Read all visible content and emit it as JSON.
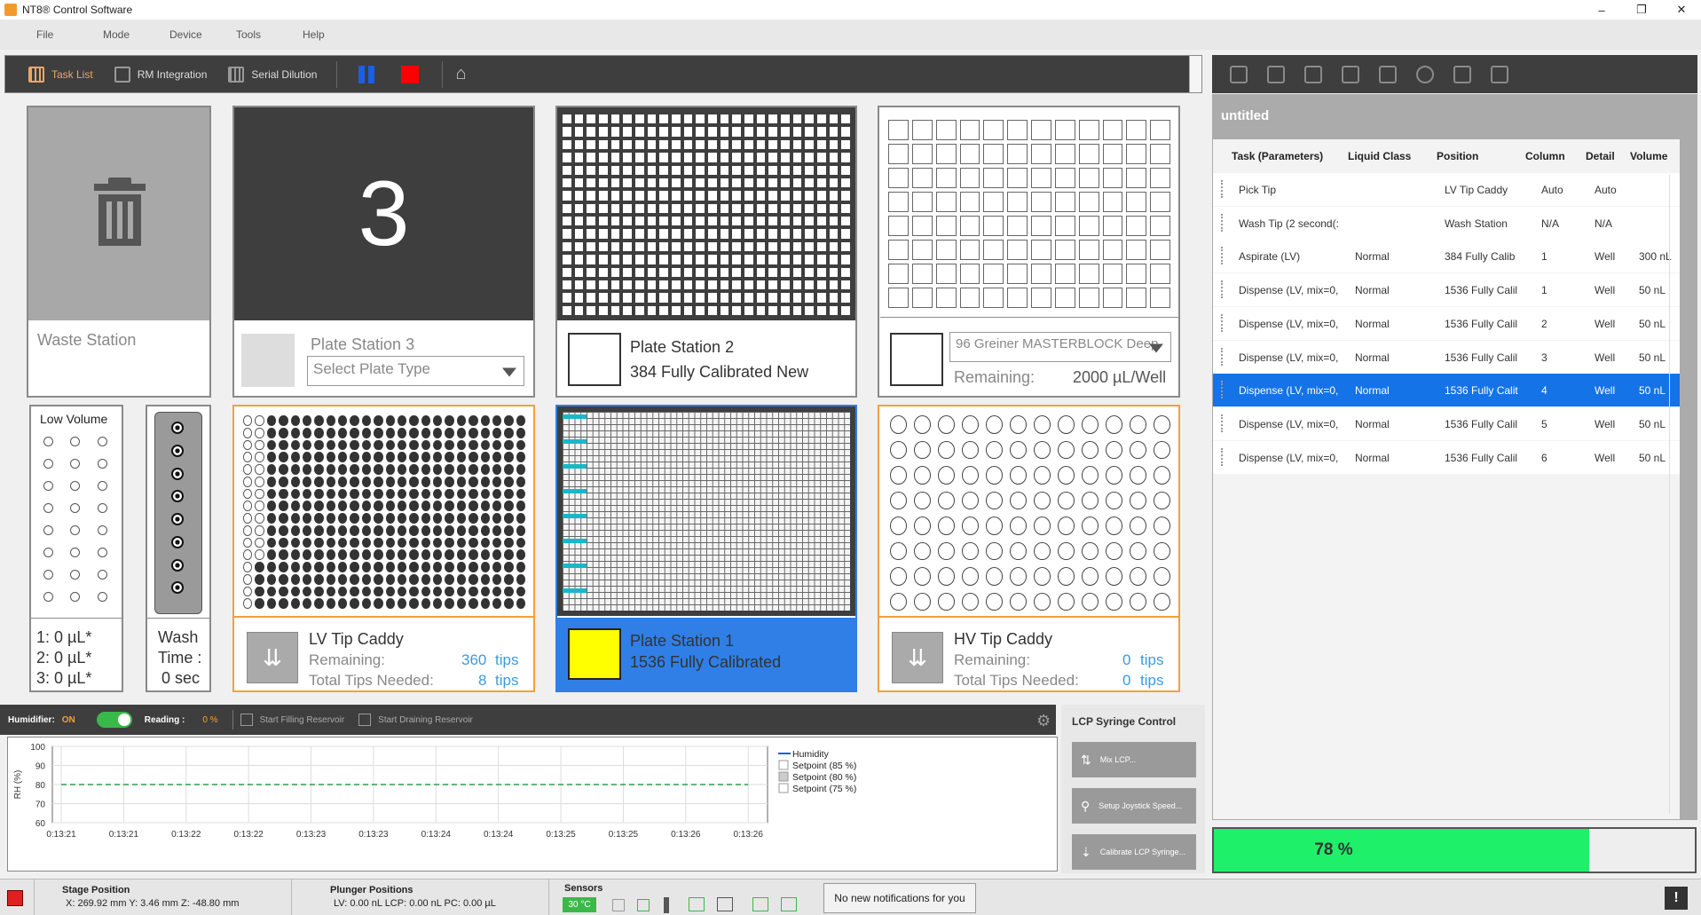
{
  "window": {
    "title": "NT8® Control Software",
    "min": "–",
    "max": "❐",
    "close": "✕"
  },
  "menu": [
    "File",
    "Mode",
    "Device",
    "Tools",
    "Help"
  ],
  "toolbar": {
    "task_list": "Task List",
    "rm_integration": "RM Integration",
    "serial_dilution": "Serial Dilution"
  },
  "colors": {
    "accent_orange": "#f3a03a",
    "selected_blue": "#1473e6",
    "dark_panel": "#3e3e3e",
    "progress_green": "#1ef06a",
    "plate1_blue": "#2f7fe6",
    "teal": "#19b8c8"
  },
  "stations": {
    "waste": {
      "label": "Waste Station"
    },
    "plate3": {
      "number": "3",
      "name": "Plate Station 3",
      "select_placeholder": "Select Plate Type"
    },
    "plate2": {
      "name": "Plate Station 2",
      "type": "384 Fully Calibrated New"
    },
    "reservoir": {
      "select_value": "96 Greiner MASTERBLOCK Deep",
      "remaining_label": "Remaining:",
      "remaining_value": "2000 µL/Well"
    },
    "low_volume": {
      "title": "Low Volume",
      "v1": "1: 0 µL*",
      "v2": "2: 0 µL*",
      "v3": "3: 0 µL*"
    },
    "wash": {
      "line1": "Wash",
      "line2": "Time :",
      "line3": "0 sec"
    },
    "lv_caddy": {
      "name": "LV Tip Caddy",
      "remaining_label": "Remaining:",
      "remaining_value": "360",
      "remaining_unit": "tips",
      "needed_label": "Total Tips Needed:",
      "needed_value": "8",
      "needed_unit": "tips"
    },
    "plate1": {
      "name": "Plate Station 1",
      "type": "1536 Fully Calibrated"
    },
    "hv_caddy": {
      "name": "HV Tip Caddy",
      "remaining_label": "Remaining:",
      "remaining_value": "0",
      "remaining_unit": "tips",
      "needed_label": "Total Tips Needed:",
      "needed_value": "0",
      "needed_unit": "tips"
    }
  },
  "task_panel": {
    "file_name": "untitled",
    "headers": [
      "Task (Parameters)",
      "Liquid Class",
      "Position",
      "Column",
      "Detail",
      "Volume"
    ],
    "rows": [
      {
        "task": "Pick Tip",
        "liquid": "",
        "position": "LV Tip Caddy",
        "column": "Auto",
        "detail": "Auto",
        "volume": ""
      },
      {
        "task": "Wash Tip (2 second(:",
        "liquid": "",
        "position": "Wash Station",
        "column": "N/A",
        "detail": "N/A",
        "volume": ""
      },
      {
        "task": "Aspirate (LV)",
        "liquid": "Normal",
        "position": "384 Fully Calib",
        "column": "1",
        "detail": "Well",
        "volume": "300 nL"
      },
      {
        "task": "Dispense (LV, mix=0,",
        "liquid": "Normal",
        "position": "1536 Fully Calil",
        "column": "1",
        "detail": "Well",
        "volume": "50 nL"
      },
      {
        "task": "Dispense (LV, mix=0,",
        "liquid": "Normal",
        "position": "1536 Fully Calil",
        "column": "2",
        "detail": "Well",
        "volume": "50 nL"
      },
      {
        "task": "Dispense (LV, mix=0,",
        "liquid": "Normal",
        "position": "1536 Fully Calil",
        "column": "3",
        "detail": "Well",
        "volume": "50 nL"
      },
      {
        "task": "Dispense (LV, mix=0,",
        "liquid": "Normal",
        "position": "1536 Fully Calit",
        "column": "4",
        "detail": "Well",
        "volume": "50 nL"
      },
      {
        "task": "Dispense (LV, mix=0,",
        "liquid": "Normal",
        "position": "1536 Fully Calil",
        "column": "5",
        "detail": "Well",
        "volume": "50 nL"
      },
      {
        "task": "Dispense (LV, mix=0,",
        "liquid": "Normal",
        "position": "1536 Fully Calil",
        "column": "6",
        "detail": "Well",
        "volume": "50 nL"
      }
    ],
    "selected_row": 6,
    "progress_text": "78 %",
    "progress_value": 78
  },
  "humidifier": {
    "label": "Humidifier:",
    "state": "ON",
    "reading_label": "Reading :",
    "reading_value": "0 %",
    "start_fill": "Start Filling Reservoir",
    "start_drain": "Start Draining Reservoir"
  },
  "chart_data": {
    "type": "line",
    "ylabel": "RH (%)",
    "ylim": [
      60,
      100
    ],
    "yticks": [
      "100",
      "90",
      "80",
      "70",
      "60"
    ],
    "x": [
      "0:13:21",
      "0:13:21",
      "0:13:22",
      "0:13:22",
      "0:13:23",
      "0:13:23",
      "0:13:24",
      "0:13:24",
      "0:13:25",
      "0:13:25",
      "0:13:26",
      "0:13:26"
    ],
    "series": [
      {
        "name": "Humidity",
        "values": []
      },
      {
        "name": "Setpoint (85 %)",
        "values": []
      },
      {
        "name": "Setpoint (80 %)",
        "values": [
          80,
          80,
          80,
          80,
          80,
          80,
          80,
          80,
          80,
          80,
          80,
          80
        ]
      },
      {
        "name": "Setpoint (75 %)",
        "values": []
      }
    ],
    "grid": true,
    "legend": "right"
  },
  "lcp": {
    "title": "LCP Syringe Control",
    "mix": "Mix LCP...",
    "joystick": "Setup Joystick Speed...",
    "calibrate": "Calibrate LCP Syringe..."
  },
  "status": {
    "stage_title": "Stage Position",
    "stage_values": "X: 269.92 mm   Y: 3.46 mm   Z: -48.80 mm",
    "plunger_title": "Plunger Positions",
    "plunger_values": "LV: 0.00 nL   LCP: 0.00 nL   PC: 0.00 µL",
    "sensors_title": "Sensors",
    "temp": "30 °C",
    "notification": "No new notifications for you"
  }
}
